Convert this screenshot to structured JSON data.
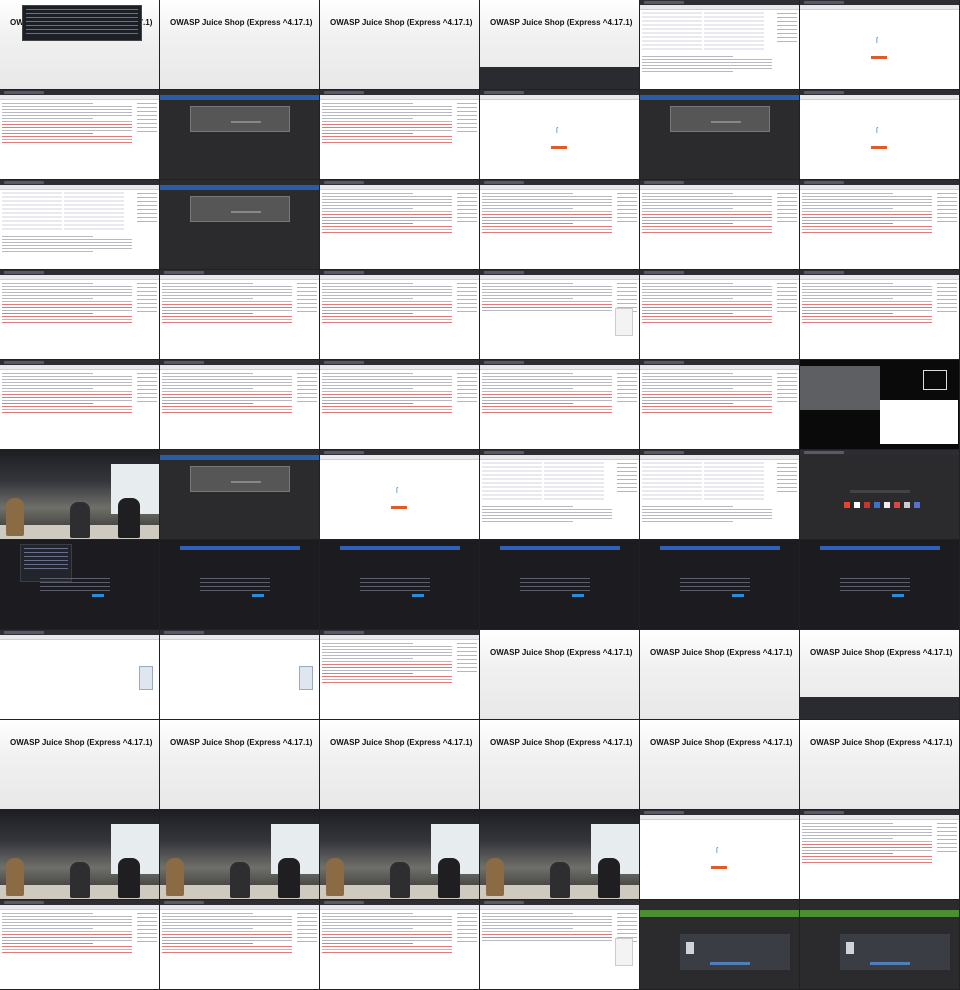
{
  "js_banner": {
    "title": "OWASP Juice Shop (Express ^4.17.1)"
  },
  "grid": {
    "columns": 6,
    "rows": 11
  },
  "thumbs": [
    {
      "kind": "terminal"
    },
    {
      "kind": "juice"
    },
    {
      "kind": "juice"
    },
    {
      "kind": "juice-dark"
    },
    {
      "kind": "burp-table"
    },
    {
      "kind": "logo"
    },
    {
      "kind": "burp"
    },
    {
      "kind": "modal"
    },
    {
      "kind": "burp"
    },
    {
      "kind": "logo"
    },
    {
      "kind": "modal"
    },
    {
      "kind": "logo"
    },
    {
      "kind": "burp-table"
    },
    {
      "kind": "modal"
    },
    {
      "kind": "burp"
    },
    {
      "kind": "burp"
    },
    {
      "kind": "burp"
    },
    {
      "kind": "burp"
    },
    {
      "kind": "burp"
    },
    {
      "kind": "burp"
    },
    {
      "kind": "burp"
    },
    {
      "kind": "burp-side"
    },
    {
      "kind": "burp"
    },
    {
      "kind": "burp"
    },
    {
      "kind": "burp"
    },
    {
      "kind": "burp"
    },
    {
      "kind": "burp"
    },
    {
      "kind": "burp"
    },
    {
      "kind": "burp"
    },
    {
      "kind": "slide"
    },
    {
      "kind": "scene"
    },
    {
      "kind": "modal"
    },
    {
      "kind": "logo"
    },
    {
      "kind": "burp-table"
    },
    {
      "kind": "burp-table"
    },
    {
      "kind": "icons"
    },
    {
      "kind": "dark-terminal"
    },
    {
      "kind": "dark-page"
    },
    {
      "kind": "dark-page"
    },
    {
      "kind": "dark-page"
    },
    {
      "kind": "dark-page"
    },
    {
      "kind": "dark-page"
    },
    {
      "kind": "blank-side"
    },
    {
      "kind": "blank-side"
    },
    {
      "kind": "burp"
    },
    {
      "kind": "juice"
    },
    {
      "kind": "juice"
    },
    {
      "kind": "juice-dark"
    },
    {
      "kind": "juice"
    },
    {
      "kind": "juice"
    },
    {
      "kind": "juice"
    },
    {
      "kind": "juice"
    },
    {
      "kind": "juice"
    },
    {
      "kind": "juice"
    },
    {
      "kind": "scene"
    },
    {
      "kind": "scene"
    },
    {
      "kind": "scene"
    },
    {
      "kind": "scene"
    },
    {
      "kind": "logo"
    },
    {
      "kind": "burp"
    },
    {
      "kind": "burp"
    },
    {
      "kind": "burp"
    },
    {
      "kind": "burp"
    },
    {
      "kind": "burp-side"
    },
    {
      "kind": "trash"
    },
    {
      "kind": "trash"
    }
  ]
}
